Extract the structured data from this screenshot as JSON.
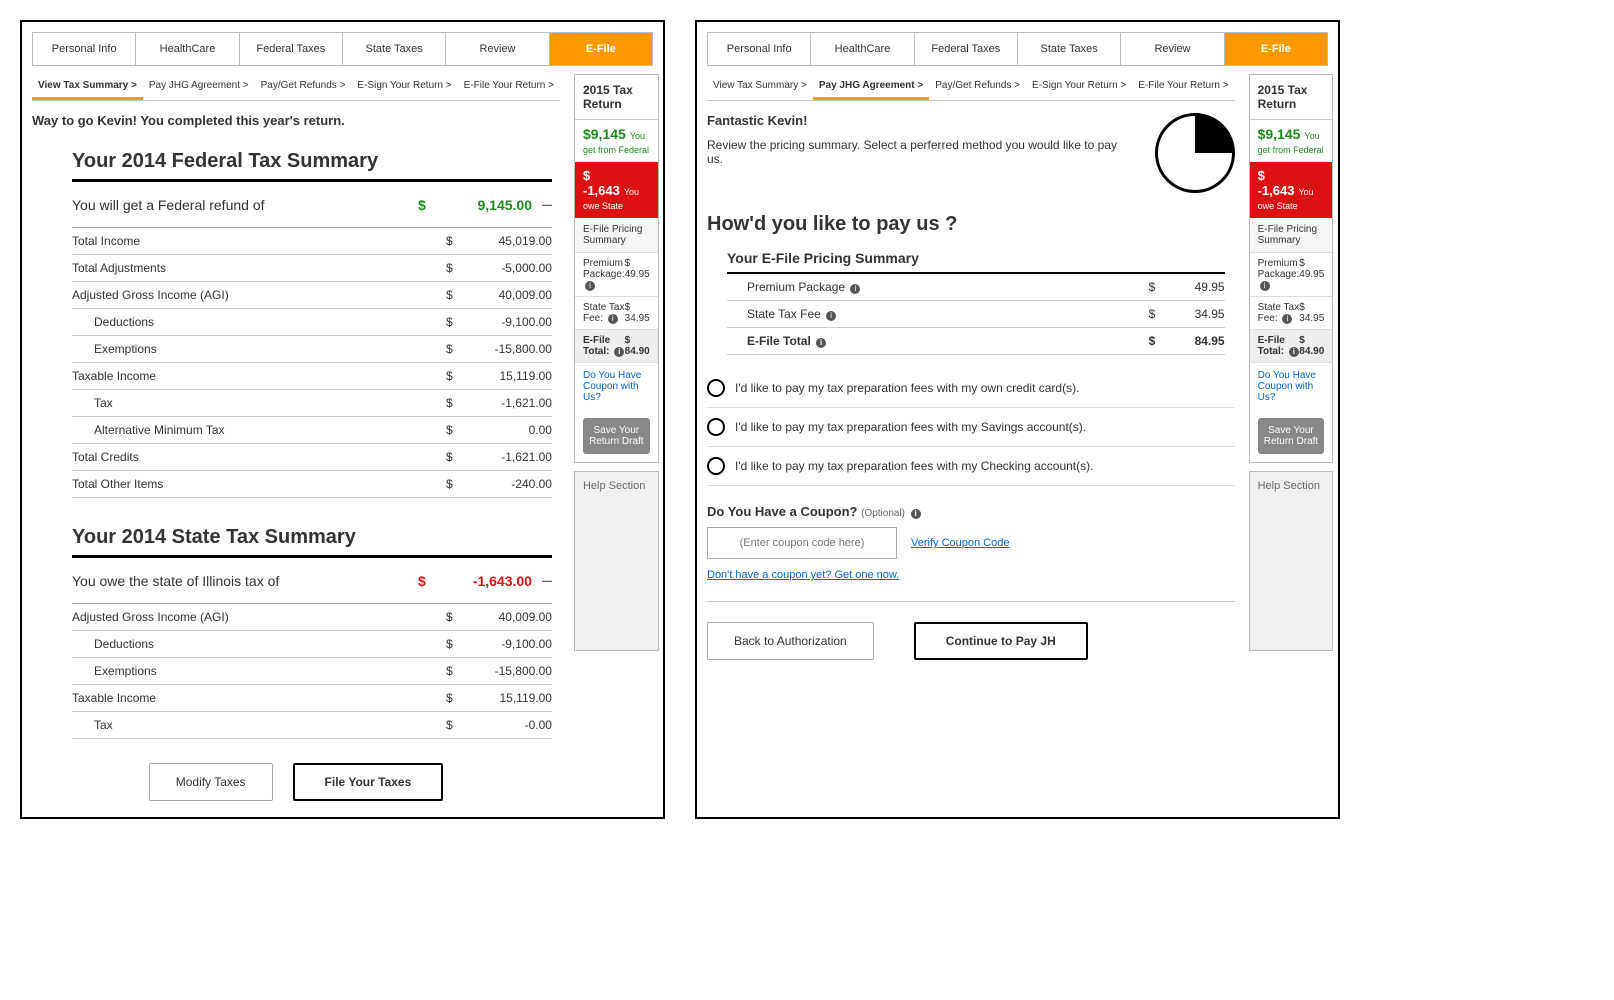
{
  "nav": {
    "items": [
      "Personal Info",
      "HealthCare",
      "Federal Taxes",
      "State Taxes",
      "Review",
      "E-File"
    ],
    "active": 5
  },
  "left": {
    "subnav": {
      "items": [
        "View Tax Summary >",
        "Pay JHG Agreement >",
        "Pay/Get Refunds >",
        "E-Sign Your Return >",
        "E-File Your Return >"
      ],
      "active": 0
    },
    "greet": "Way to go Kevin! You completed this year's return.",
    "federal": {
      "title": "Your 2014 Federal Tax Summary",
      "hero_label": "You will get a Federal refund of",
      "hero_cur": "$",
      "hero_amt": "9,145.00",
      "toggle": "–",
      "rows": [
        {
          "label": "Total Income",
          "cur": "$",
          "amt": "45,019.00"
        },
        {
          "label": "Total Adjustments",
          "cur": "$",
          "amt": "-5,000.00"
        },
        {
          "label": "Adjusted Gross Income (AGI)",
          "cur": "$",
          "amt": "40,009.00"
        },
        {
          "label": "Deductions",
          "cur": "$",
          "amt": "-9,100.00",
          "sub": true
        },
        {
          "label": "Exemptions",
          "cur": "$",
          "amt": "-15,800.00",
          "sub": true
        },
        {
          "label": "Taxable Income",
          "cur": "$",
          "amt": "15,119.00"
        },
        {
          "label": "Tax",
          "cur": "$",
          "amt": "-1,621.00",
          "sub": true
        },
        {
          "label": "Alternative Minimum Tax",
          "cur": "$",
          "amt": "0.00",
          "sub": true
        },
        {
          "label": "Total Credits",
          "cur": "$",
          "amt": "-1,621.00"
        },
        {
          "label": "Total Other Items",
          "cur": "$",
          "amt": "-240.00"
        }
      ]
    },
    "state": {
      "title": "Your 2014 State Tax Summary",
      "hero_label": "You owe the state of Illinois tax of",
      "hero_cur": "$",
      "hero_amt": "-1,643.00",
      "toggle": "–",
      "rows": [
        {
          "label": "Adjusted Gross Income (AGI)",
          "cur": "$",
          "amt": "40,009.00"
        },
        {
          "label": "Deductions",
          "cur": "$",
          "amt": "-9,100.00",
          "sub": true
        },
        {
          "label": "Exemptions",
          "cur": "$",
          "amt": "-15,800.00",
          "sub": true
        },
        {
          "label": "Taxable Income",
          "cur": "$",
          "amt": "15,119.00"
        },
        {
          "label": "Tax",
          "cur": "$",
          "amt": "-0.00",
          "sub": true
        }
      ]
    },
    "btns": {
      "modify": "Modify Taxes",
      "file": "File Your Taxes"
    }
  },
  "right": {
    "subnav": {
      "items": [
        "View Tax Summary >",
        "Pay JHG Agreement >",
        "Pay/Get Refunds >",
        "E-Sign Your Return >",
        "E-File Your Return >"
      ],
      "active": 1
    },
    "intro": {
      "h": "Fantastic Kevin!",
      "p": "Review the pricing summary. Select a perferred method you would like to pay us."
    },
    "q": "How'd you like to pay us ?",
    "price": {
      "title": "Your E-File Pricing Summary",
      "rows": [
        {
          "label": "Premium Package",
          "info": "ⓘ",
          "cur": "$",
          "amt": "49.95"
        },
        {
          "label": "State Tax Fee",
          "info": "ⓘ",
          "cur": "$",
          "amt": "34.95"
        },
        {
          "label": "E-File Total",
          "info": "ⓘ",
          "cur": "$",
          "amt": "84.95",
          "bold": true
        }
      ]
    },
    "options": [
      "I'd like to pay my tax preparation fees with my own credit card(s).",
      "I'd like to pay my tax preparation fees with my Savings account(s).",
      "I'd like to pay my tax preparation fees with my Checking account(s)."
    ],
    "coupon": {
      "h": "Do You Have a Coupon?",
      "opt": "(Optional)",
      "ph": "(Enter coupon code here)",
      "verify": "Verify Coupon Code",
      "getone": "Don't have a coupon yet? Get one now."
    },
    "btns": {
      "back": "Back to Authorization",
      "cont": "Continue to Pay JH"
    }
  },
  "sidebar": {
    "title": "2015 Tax Return",
    "refund": {
      "v": "$9,145",
      "t": "You get from Federal"
    },
    "owe": {
      "v": "$ -1,643",
      "t": "You owe State"
    },
    "sub": "E-File Pricing Summary",
    "lines": [
      {
        "l": "Premium Package:",
        "i": "ⓘ",
        "v": "$ 49.95"
      },
      {
        "l": "State Tax Fee:",
        "i": "ⓘ",
        "v": "$ 34.95"
      },
      {
        "l": "E-File Total:",
        "i": "ⓘ",
        "v": "$ 84.90",
        "total": true
      }
    ],
    "link": "Do You Have Coupon with Us?",
    "btn": "Save Your Return Draft",
    "help": "Help Section"
  }
}
